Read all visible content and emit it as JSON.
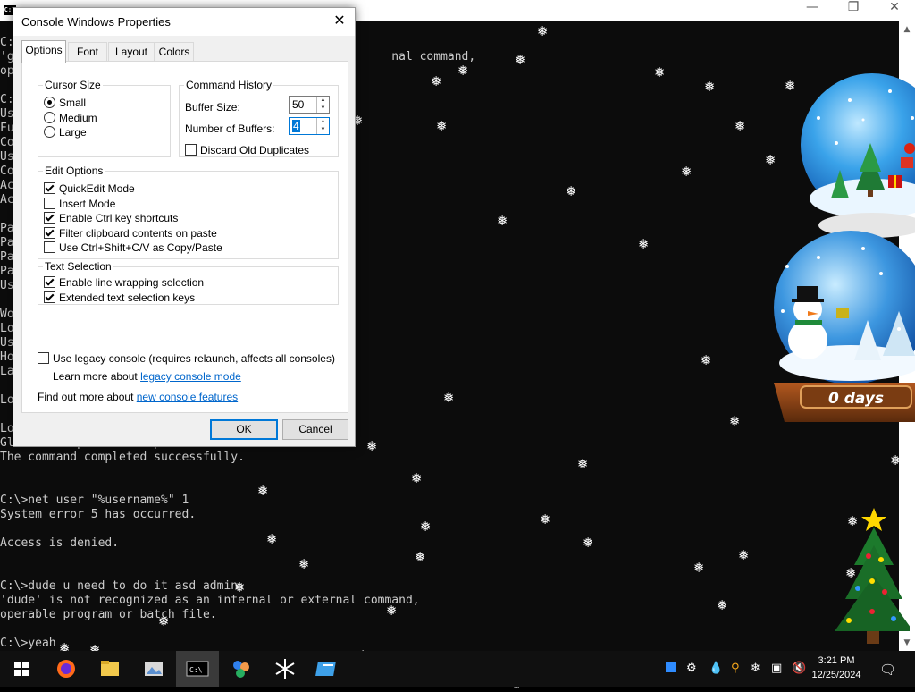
{
  "console": {
    "window_icon_text": "C:\\",
    "lines": [
      "C:",
      "'g                                                      nal command,",
      "op",
      "",
      "C:",
      "Us",
      "Fu",
      "Co",
      "Us",
      "Co",
      "Ac",
      "Ac",
      "",
      "Pa",
      "Pa",
      "Pa",
      "Pa",
      "Us",
      "",
      "Wo",
      "Lo",
      "Us",
      "Ho",
      "La",
      "",
      "Lo",
      "",
      "Lo",
      "Global Group memberships      None",
      "The command completed successfully.",
      "",
      "",
      "C:\\>net user \"%username%\" 1",
      "System error 5 has occurred.",
      "",
      "Access is denied.",
      "",
      "",
      "C:\\>dude u need to do it asd admin",
      "'dude' is not recognized as an internal or external command,",
      "operable program or batch file.",
      "",
      "C:\\>yeah"
    ]
  },
  "globe": {
    "days_label": "0 days"
  },
  "dialog": {
    "title": "Console Windows Properties",
    "tabs": [
      "Options",
      "Font",
      "Layout",
      "Colors"
    ],
    "cursor_size": {
      "legend": "Cursor Size",
      "options": [
        {
          "label": "Small",
          "selected": true
        },
        {
          "label": "Medium",
          "selected": false
        },
        {
          "label": "Large",
          "selected": false
        }
      ]
    },
    "command_history": {
      "legend": "Command History",
      "buffer_size_label": "Buffer Size:",
      "buffer_size_value": "50",
      "num_buffers_label": "Number of Buffers:",
      "num_buffers_value": "4",
      "discard_label": "Discard Old Duplicates",
      "discard_checked": false
    },
    "edit_options": {
      "legend": "Edit Options",
      "items": [
        {
          "label": "QuickEdit Mode",
          "checked": true
        },
        {
          "label": "Insert Mode",
          "checked": false
        },
        {
          "label": "Enable Ctrl key shortcuts",
          "checked": true
        },
        {
          "label": "Filter clipboard contents on paste",
          "checked": true
        },
        {
          "label": "Use Ctrl+Shift+C/V as Copy/Paste",
          "checked": false
        }
      ]
    },
    "text_selection": {
      "legend": "Text Selection",
      "items": [
        {
          "label": "Enable line wrapping selection",
          "checked": true
        },
        {
          "label": "Extended text selection keys",
          "checked": true
        }
      ]
    },
    "legacy": {
      "label": "Use legacy console (requires relaunch, affects all consoles)",
      "checked": false,
      "learn_prefix": "Learn more about ",
      "learn_link": "legacy console mode"
    },
    "features": {
      "prefix": "Find out more about ",
      "link": "new console features"
    },
    "ok_label": "OK",
    "cancel_label": "Cancel"
  },
  "taskbar": {
    "apps": [
      "windows-start-icon",
      "firefox-icon",
      "file-explorer-icon",
      "photos-icon",
      "command-prompt-icon",
      "paint-icon",
      "snowflake-app-icon",
      "notepad-app-icon"
    ],
    "tray_icons": [
      "blue-square-icon",
      "gear-icon",
      "water-drop-icon",
      "pen-icon",
      "search-icon",
      "snowflake-icon",
      "network-icon",
      "volume-muted-icon"
    ],
    "time": "3:21 PM",
    "date": "12/25/2024",
    "accent_color": "#0078d7"
  }
}
